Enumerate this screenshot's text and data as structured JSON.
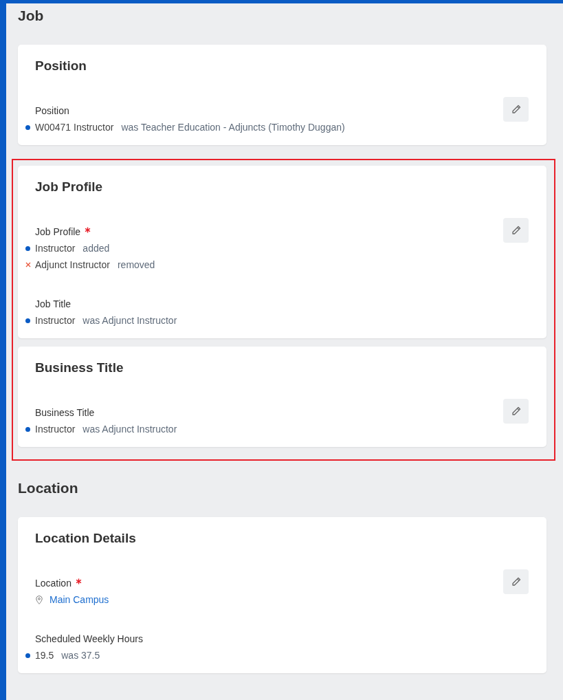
{
  "sections": [
    {
      "title": "Job",
      "cards": [
        {
          "title": "Position",
          "highlighted": false,
          "fields": [
            {
              "label": "Position",
              "required": false,
              "values": [
                {
                  "kind": "changed",
                  "text": "W00471 Instructor",
                  "note": "was Teacher Education - Adjuncts (Timothy Duggan)"
                }
              ]
            }
          ]
        },
        {
          "title": "Job Profile",
          "highlighted": true,
          "fields": [
            {
              "label": "Job Profile",
              "required": true,
              "values": [
                {
                  "kind": "changed",
                  "text": "Instructor",
                  "note": "added"
                },
                {
                  "kind": "removed",
                  "text": "Adjunct Instructor",
                  "note": "removed"
                }
              ]
            },
            {
              "label": "Job Title",
              "required": false,
              "values": [
                {
                  "kind": "changed",
                  "text": "Instructor",
                  "note": "was Adjunct Instructor"
                }
              ]
            }
          ]
        },
        {
          "title": "Business Title",
          "highlighted": true,
          "fields": [
            {
              "label": "Business Title",
              "required": false,
              "values": [
                {
                  "kind": "changed",
                  "text": "Instructor",
                  "note": "was Adjunct Instructor"
                }
              ]
            }
          ]
        }
      ]
    },
    {
      "title": "Location",
      "cards": [
        {
          "title": "Location Details",
          "highlighted": false,
          "fields": [
            {
              "label": "Location",
              "required": true,
              "values": [
                {
                  "kind": "location",
                  "text": "Main Campus"
                }
              ]
            },
            {
              "label": "Scheduled Weekly Hours",
              "required": false,
              "values": [
                {
                  "kind": "changed",
                  "text": "19.5",
                  "note": "was 37.5"
                }
              ]
            }
          ]
        }
      ]
    }
  ]
}
